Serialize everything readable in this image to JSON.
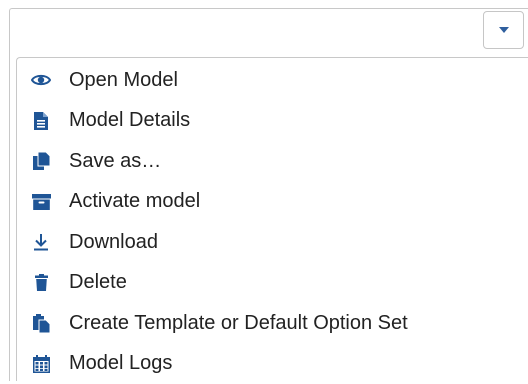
{
  "colors": {
    "icon": "#1f5596",
    "text": "#222222",
    "border": "#c8c8c8",
    "caret": "#2f5f9e"
  },
  "toggle": {
    "icon": "caret-down-icon"
  },
  "menu": {
    "items": [
      {
        "label": "Open Model",
        "icon": "eye-icon"
      },
      {
        "label": "Model Details",
        "icon": "file-details-icon"
      },
      {
        "label": "Save as…",
        "icon": "copy-icon"
      },
      {
        "label": "Activate model",
        "icon": "archive-icon"
      },
      {
        "label": "Download",
        "icon": "download-icon"
      },
      {
        "label": "Delete",
        "icon": "trash-icon"
      },
      {
        "label": "Create Template or Default Option Set",
        "icon": "paste-icon"
      },
      {
        "label": "Model Logs",
        "icon": "calendar-icon"
      }
    ]
  }
}
